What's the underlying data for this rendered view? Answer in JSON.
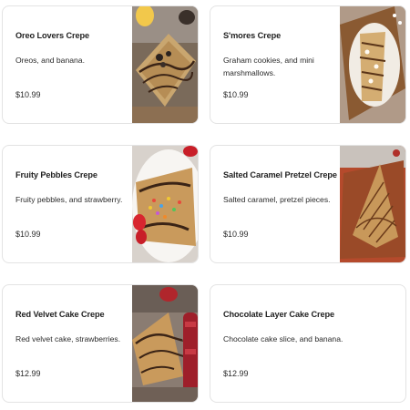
{
  "menu": {
    "items": [
      {
        "name": "Oreo Lovers Crepe",
        "description": "Oreos, and banana.",
        "price": "$10.99",
        "image": "oreo-crepe-photo"
      },
      {
        "name": "S'mores Crepe",
        "description": "Graham cookies, and mini marshmallows.",
        "price": "$10.99",
        "image": "smores-crepe-photo"
      },
      {
        "name": "Fruity Pebbles Crepe",
        "description": "Fruity pebbles, and strawberry.",
        "price": "$10.99",
        "image": "fruity-pebbles-crepe-photo"
      },
      {
        "name": "Salted Caramel Pretzel Crepe",
        "description": "Salted caramel, pretzel pieces.",
        "price": "$10.99",
        "image": "salted-caramel-crepe-photo"
      },
      {
        "name": "Red Velvet Cake Crepe",
        "description": "Red velvet cake, strawberries.",
        "price": "$12.99",
        "image": "red-velvet-crepe-photo"
      },
      {
        "name": "Chocolate Layer Cake Crepe",
        "description": "Chocolate cake slice, and banana.",
        "price": "$12.99"
      }
    ]
  }
}
